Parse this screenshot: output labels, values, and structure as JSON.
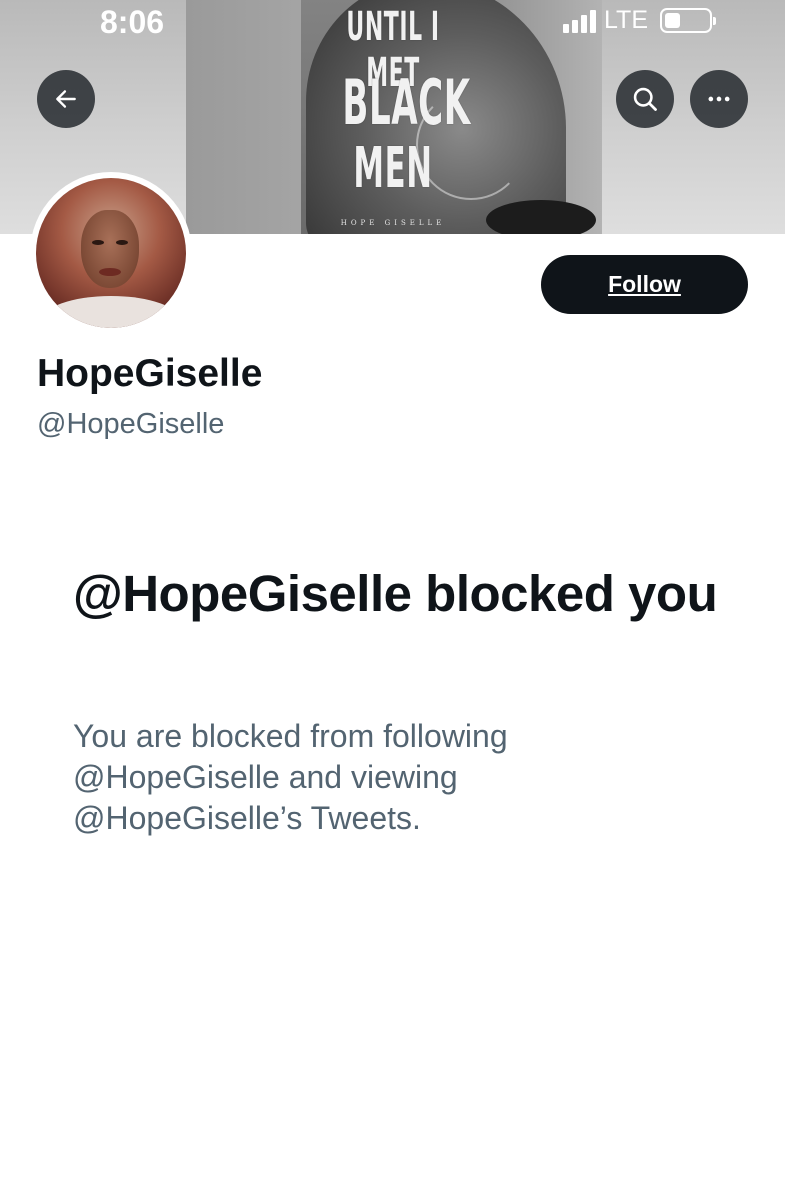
{
  "status_bar": {
    "time": "8:06",
    "network": "LTE"
  },
  "banner": {
    "cover_line1": "UNTIL I MET",
    "cover_line2": "BLACK",
    "cover_line3": "MEN",
    "cover_author": "HOPE GISELLE"
  },
  "header": {
    "back_icon": "arrow-left-icon",
    "search_icon": "search-icon",
    "more_icon": "more-horizontal-icon"
  },
  "profile": {
    "display_name": "HopeGiselle",
    "handle": "@HopeGiselle",
    "follow_label": "Follow"
  },
  "blocked": {
    "title": "@HopeGiselle blocked you",
    "description_lines": [
      "You are blocked from following",
      "@HopeGiselle and viewing",
      "@HopeGiselle’s Tweets."
    ]
  },
  "colors": {
    "primary_text": "#0f1419",
    "secondary_text": "#536471",
    "follow_bg": "#0f1419"
  }
}
